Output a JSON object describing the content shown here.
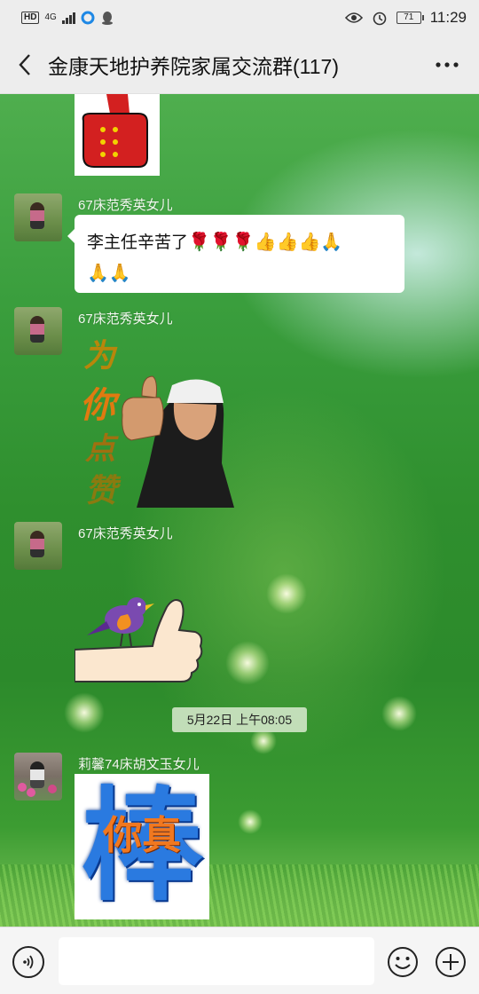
{
  "status_bar": {
    "hd": "HD",
    "network": "4G",
    "time": "11:29",
    "battery": "71"
  },
  "header": {
    "title": "金康天地护养院家属交流群(117)",
    "back_icon": "chevron-left-icon",
    "more_icon": "more-dots-icon",
    "more_label": "···"
  },
  "messages": [
    {
      "sender": "",
      "type": "sticker",
      "sticker": "thumbs-up-red-glove-sticker"
    },
    {
      "sender": "67床范秀英女儿",
      "type": "text",
      "text": "李主任辛苦了",
      "emoji_line1": "🌹🌹🌹👍👍👍🙏",
      "emoji_line2": "🙏🙏"
    },
    {
      "sender": "67床范秀英女儿",
      "type": "sticker",
      "sticker": "wei-ni-dian-zan-sticker",
      "sticker_text": [
        "为",
        "你",
        "点",
        "赞"
      ]
    },
    {
      "sender": "67床范秀英女儿",
      "type": "sticker",
      "sticker": "bird-on-thumb-sticker"
    },
    {
      "type": "time",
      "text": "5月22日 上午08:05"
    },
    {
      "sender": "莉馨74床胡文玉女儿",
      "type": "sticker",
      "sticker": "ni-zhen-bang-sticker",
      "sticker_text": [
        "你真",
        "棒"
      ]
    }
  ],
  "input_bar": {
    "voice_icon": "voice-icon",
    "emoji_icon": "emoji-icon",
    "plus_icon": "plus-icon",
    "value": ""
  },
  "colors": {
    "chat_green": "#3a9e3d",
    "bubble": "#ffffff",
    "bar_bg": "#ededed"
  }
}
